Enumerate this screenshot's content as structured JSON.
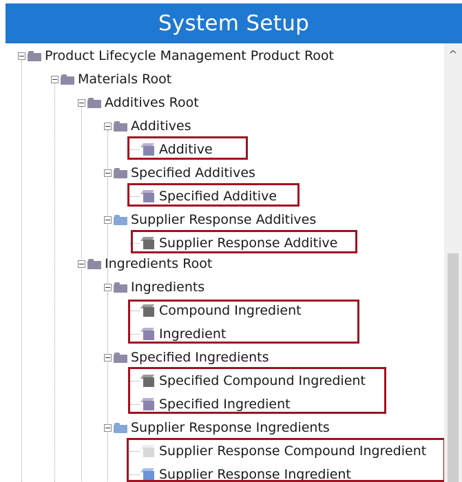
{
  "window": {
    "title": "System Setup"
  },
  "scrollbar": {
    "up_arrow_glyph": "^"
  },
  "tree": {
    "root": "Product Lifecycle Management Product Root",
    "materials_root": "Materials Root",
    "additives_root": "Additives Root",
    "additives": "Additives",
    "additive": "Additive",
    "specified_additives": "Specified Additives",
    "specified_additive": "Specified Additive",
    "supplier_response_additives": "Supplier Response Additives",
    "supplier_response_additive": "Supplier Response Additive",
    "ingredients_root": "Ingredients Root",
    "ingredients": "Ingredients",
    "compound_ingredient": "Compound Ingredient",
    "ingredient": "Ingredient",
    "specified_ingredients": "Specified Ingredients",
    "specified_compound_ingredient": "Specified Compound Ingredient",
    "specified_ingredient": "Specified Ingredient",
    "supplier_response_ingredients": "Supplier Response Ingredients",
    "supplier_response_compound_ingredient": "Supplier Response Compound Ingredient",
    "supplier_response_ingredient": "Supplier Response Ingredient"
  },
  "icons": {
    "folder_purple": "folder-icon",
    "folder_blue": "folder-blue-icon",
    "cube_purple": "cube-icon",
    "cube_gray": "cube-gray-icon",
    "cube_blue": "cube-blue-icon",
    "cube_light": "cube-light-icon"
  },
  "colors": {
    "title_bar": "#1f78d1",
    "highlight": "#a01220",
    "folder_purple": "#8e8aa6",
    "folder_blue": "#86a8d8",
    "cube_purple": "#8a84ad",
    "cube_gray": "#6b6b6b",
    "cube_blue": "#6b93d6",
    "cube_light": "#d8d8d8"
  }
}
